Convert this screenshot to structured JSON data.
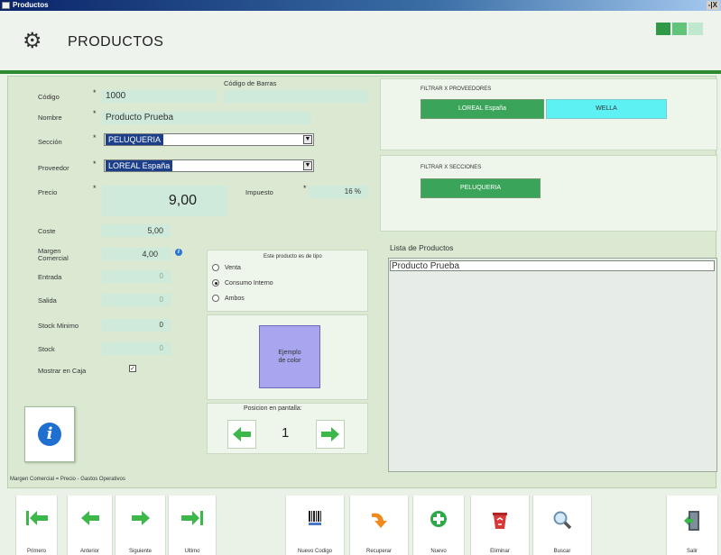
{
  "window": {
    "title": "Productos",
    "controls": "-|X"
  },
  "header": {
    "title": "PRODUCTOS",
    "indicators": [
      "#2e9a46",
      "#62c47a",
      "#c0e8cf"
    ]
  },
  "form": {
    "codigo_barras_label": "Código de Barras",
    "codigo": {
      "label": "Código",
      "value": "1000"
    },
    "nombre": {
      "label": "Nombre",
      "value": "Producto Prueba"
    },
    "seccion": {
      "label": "Sección",
      "value": "PELUQUERIA"
    },
    "proveedor": {
      "label": "Proveedor",
      "value": "LOREAL España"
    },
    "precio": {
      "label": "Precio",
      "value": "9,00"
    },
    "impuesto": {
      "label": "Impuesto",
      "value": "16 %"
    },
    "coste": {
      "label": "Coste",
      "value": "5,00"
    },
    "margen": {
      "label": "Margen\nComercial",
      "value": "4,00"
    },
    "entrada": {
      "label": "Entrada",
      "value": "0"
    },
    "salida": {
      "label": "Salida",
      "value": "0"
    },
    "stock_minimo": {
      "label": "Stock Minimo",
      "value": "0"
    },
    "stock": {
      "label": "Stock",
      "value": "0"
    },
    "mostrar_caja": {
      "label": "Mostrar en Caja",
      "checked": true
    },
    "required_mark": "*",
    "footnote": "Margen Comercial = Precio - Gastos Operativos"
  },
  "tipo": {
    "title": "Este producto es de tipo",
    "options": [
      "Venta",
      "Consumo Interno",
      "Ambos"
    ],
    "selected_index": 1
  },
  "color": {
    "label": "Ejemplo\nde color",
    "swatch": "#a7a6ef"
  },
  "posicion": {
    "label": "Posicion en pantalla:",
    "value": "1"
  },
  "filters": {
    "proveedores_title": "FILTRAR X PROVEEDORES",
    "proveedores": [
      {
        "label": "LOREAL España",
        "color": "#3aa55a"
      },
      {
        "label": "WELLA",
        "color": "#5df1f4"
      }
    ],
    "secciones_title": "FILTRAR X SECCIONES",
    "secciones": [
      {
        "label": "PELUQUERIA",
        "color": "#3aa55a"
      }
    ]
  },
  "lista": {
    "title": "Lista de Productos",
    "items": [
      "Producto Prueba"
    ]
  },
  "toolbar": {
    "nav": [
      "Primero",
      "Anterior",
      "Siguiente",
      "Ultimo"
    ],
    "actions": [
      "Nuevo Codigo",
      "Recuperar",
      "Nuevo",
      "Eliminar",
      "Buscar"
    ],
    "exit": "Salir"
  },
  "icons": {
    "first": "arrow-first-icon",
    "prev": "arrow-left-icon",
    "next": "arrow-right-icon",
    "last": "arrow-last-icon",
    "barcode": "barcode-icon",
    "recover": "recover-arrow-icon",
    "new": "plus-circle-icon",
    "delete": "recycle-bin-icon",
    "search": "magnifier-icon",
    "exit": "exit-door-icon",
    "info": "info-icon",
    "settings": "gear-icon"
  },
  "colors": {
    "accent_green": "#2e8a2e",
    "field_bg": "#cfeadb",
    "arrow_green": "#3cb84a"
  }
}
